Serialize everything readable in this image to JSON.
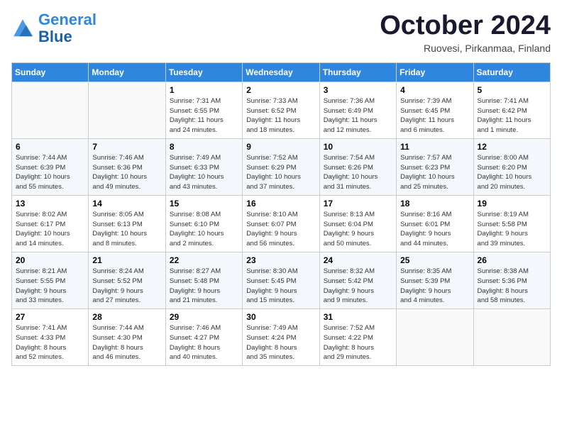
{
  "header": {
    "logo_line1": "General",
    "logo_line2": "Blue",
    "month": "October 2024",
    "location": "Ruovesi, Pirkanmaa, Finland"
  },
  "weekdays": [
    "Sunday",
    "Monday",
    "Tuesday",
    "Wednesday",
    "Thursday",
    "Friday",
    "Saturday"
  ],
  "weeks": [
    [
      {
        "day": "",
        "info": ""
      },
      {
        "day": "",
        "info": ""
      },
      {
        "day": "1",
        "info": "Sunrise: 7:31 AM\nSunset: 6:55 PM\nDaylight: 11 hours\nand 24 minutes."
      },
      {
        "day": "2",
        "info": "Sunrise: 7:33 AM\nSunset: 6:52 PM\nDaylight: 11 hours\nand 18 minutes."
      },
      {
        "day": "3",
        "info": "Sunrise: 7:36 AM\nSunset: 6:49 PM\nDaylight: 11 hours\nand 12 minutes."
      },
      {
        "day": "4",
        "info": "Sunrise: 7:39 AM\nSunset: 6:45 PM\nDaylight: 11 hours\nand 6 minutes."
      },
      {
        "day": "5",
        "info": "Sunrise: 7:41 AM\nSunset: 6:42 PM\nDaylight: 11 hours\nand 1 minute."
      }
    ],
    [
      {
        "day": "6",
        "info": "Sunrise: 7:44 AM\nSunset: 6:39 PM\nDaylight: 10 hours\nand 55 minutes."
      },
      {
        "day": "7",
        "info": "Sunrise: 7:46 AM\nSunset: 6:36 PM\nDaylight: 10 hours\nand 49 minutes."
      },
      {
        "day": "8",
        "info": "Sunrise: 7:49 AM\nSunset: 6:33 PM\nDaylight: 10 hours\nand 43 minutes."
      },
      {
        "day": "9",
        "info": "Sunrise: 7:52 AM\nSunset: 6:29 PM\nDaylight: 10 hours\nand 37 minutes."
      },
      {
        "day": "10",
        "info": "Sunrise: 7:54 AM\nSunset: 6:26 PM\nDaylight: 10 hours\nand 31 minutes."
      },
      {
        "day": "11",
        "info": "Sunrise: 7:57 AM\nSunset: 6:23 PM\nDaylight: 10 hours\nand 25 minutes."
      },
      {
        "day": "12",
        "info": "Sunrise: 8:00 AM\nSunset: 6:20 PM\nDaylight: 10 hours\nand 20 minutes."
      }
    ],
    [
      {
        "day": "13",
        "info": "Sunrise: 8:02 AM\nSunset: 6:17 PM\nDaylight: 10 hours\nand 14 minutes."
      },
      {
        "day": "14",
        "info": "Sunrise: 8:05 AM\nSunset: 6:13 PM\nDaylight: 10 hours\nand 8 minutes."
      },
      {
        "day": "15",
        "info": "Sunrise: 8:08 AM\nSunset: 6:10 PM\nDaylight: 10 hours\nand 2 minutes."
      },
      {
        "day": "16",
        "info": "Sunrise: 8:10 AM\nSunset: 6:07 PM\nDaylight: 9 hours\nand 56 minutes."
      },
      {
        "day": "17",
        "info": "Sunrise: 8:13 AM\nSunset: 6:04 PM\nDaylight: 9 hours\nand 50 minutes."
      },
      {
        "day": "18",
        "info": "Sunrise: 8:16 AM\nSunset: 6:01 PM\nDaylight: 9 hours\nand 44 minutes."
      },
      {
        "day": "19",
        "info": "Sunrise: 8:19 AM\nSunset: 5:58 PM\nDaylight: 9 hours\nand 39 minutes."
      }
    ],
    [
      {
        "day": "20",
        "info": "Sunrise: 8:21 AM\nSunset: 5:55 PM\nDaylight: 9 hours\nand 33 minutes."
      },
      {
        "day": "21",
        "info": "Sunrise: 8:24 AM\nSunset: 5:52 PM\nDaylight: 9 hours\nand 27 minutes."
      },
      {
        "day": "22",
        "info": "Sunrise: 8:27 AM\nSunset: 5:48 PM\nDaylight: 9 hours\nand 21 minutes."
      },
      {
        "day": "23",
        "info": "Sunrise: 8:30 AM\nSunset: 5:45 PM\nDaylight: 9 hours\nand 15 minutes."
      },
      {
        "day": "24",
        "info": "Sunrise: 8:32 AM\nSunset: 5:42 PM\nDaylight: 9 hours\nand 9 minutes."
      },
      {
        "day": "25",
        "info": "Sunrise: 8:35 AM\nSunset: 5:39 PM\nDaylight: 9 hours\nand 4 minutes."
      },
      {
        "day": "26",
        "info": "Sunrise: 8:38 AM\nSunset: 5:36 PM\nDaylight: 8 hours\nand 58 minutes."
      }
    ],
    [
      {
        "day": "27",
        "info": "Sunrise: 7:41 AM\nSunset: 4:33 PM\nDaylight: 8 hours\nand 52 minutes."
      },
      {
        "day": "28",
        "info": "Sunrise: 7:44 AM\nSunset: 4:30 PM\nDaylight: 8 hours\nand 46 minutes."
      },
      {
        "day": "29",
        "info": "Sunrise: 7:46 AM\nSunset: 4:27 PM\nDaylight: 8 hours\nand 40 minutes."
      },
      {
        "day": "30",
        "info": "Sunrise: 7:49 AM\nSunset: 4:24 PM\nDaylight: 8 hours\nand 35 minutes."
      },
      {
        "day": "31",
        "info": "Sunrise: 7:52 AM\nSunset: 4:22 PM\nDaylight: 8 hours\nand 29 minutes."
      },
      {
        "day": "",
        "info": ""
      },
      {
        "day": "",
        "info": ""
      }
    ]
  ]
}
